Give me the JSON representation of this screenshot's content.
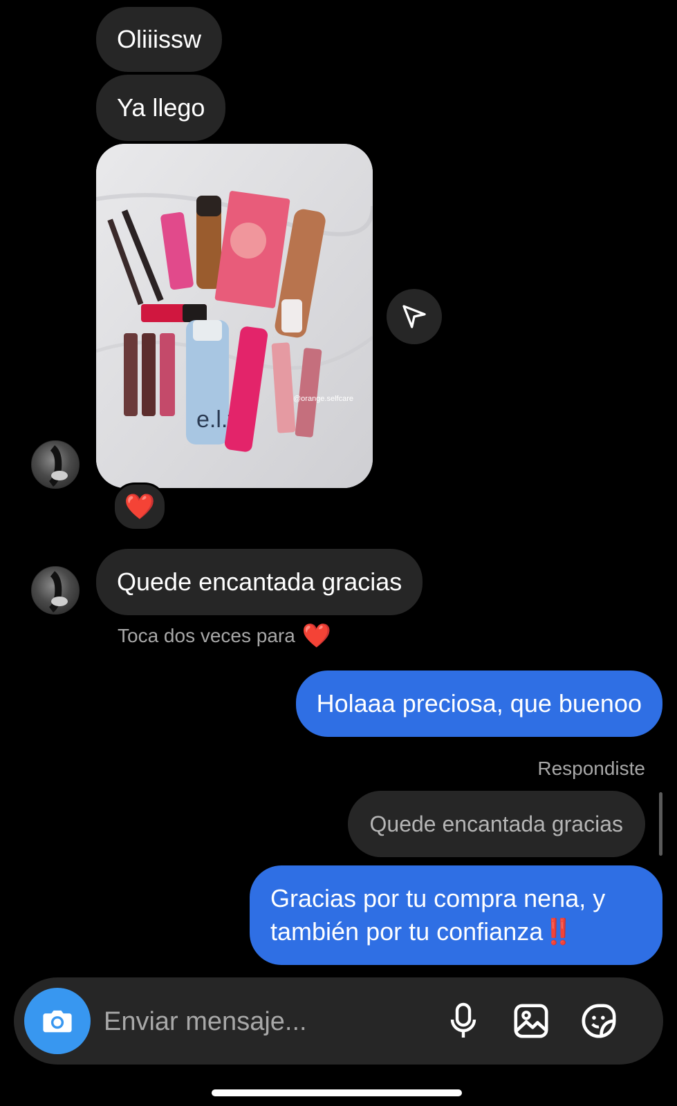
{
  "messages": {
    "msg1": "Oliiissw",
    "msg2": "Ya llego",
    "photo_watermark": "@orange.selfcare",
    "photo_reaction": "❤️",
    "msg3": "Quede encantada gracias",
    "double_tap_hint": "Toca dos veces para",
    "double_tap_heart": "❤️",
    "sent1": "Holaaa preciosa, que buenoo",
    "replied_label": "Respondiste",
    "quoted_text": "Quede encantada gracias",
    "sent2_main": "Gracias por tu compra nena, y también por tu confianza",
    "sent2_emoji": "‼️"
  },
  "composer": {
    "placeholder": "Enviar mensaje...",
    "icons": [
      "camera-icon",
      "microphone-icon",
      "gallery-icon",
      "sticker-icon"
    ]
  },
  "colors": {
    "background": "#000000",
    "incoming_bubble": "#262626",
    "outgoing_bubble": "#2f6fe4",
    "camera_button": "#3897f0",
    "muted_text": "#a8a8a8",
    "heart": "#ed1c24"
  }
}
